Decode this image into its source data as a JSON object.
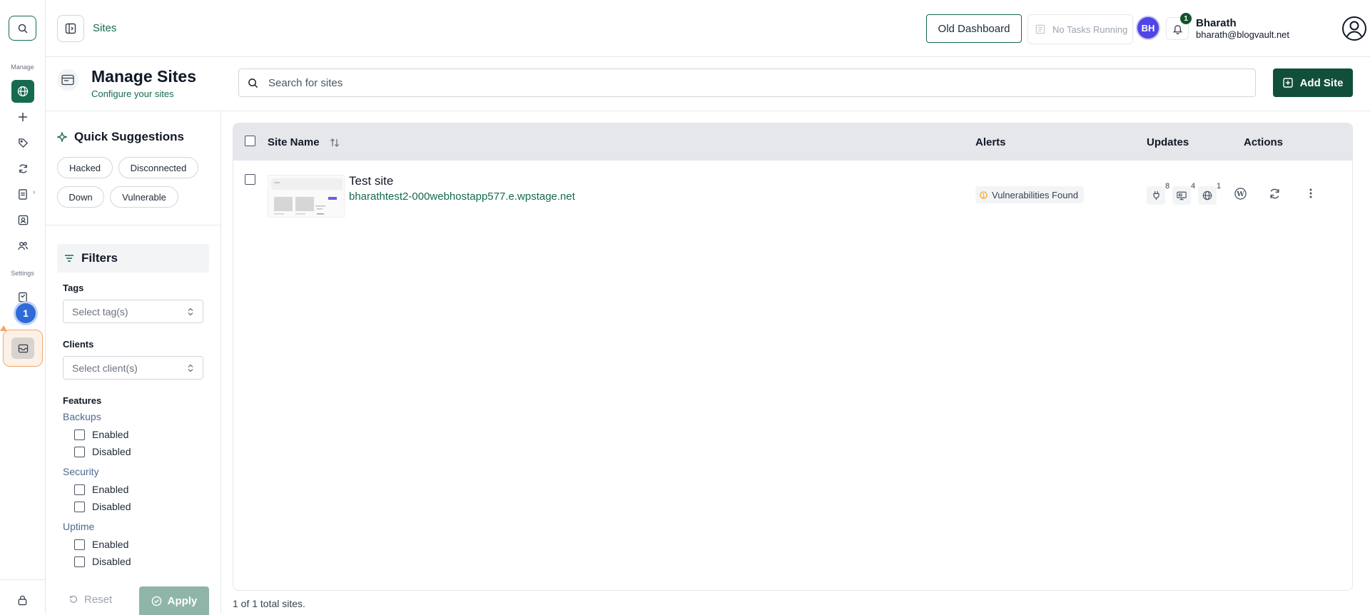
{
  "rail": {
    "manage_label": "Manage",
    "settings_label": "Settings",
    "tour_step": "1",
    "icons": [
      "search-icon",
      "globe-icon",
      "plus-icon",
      "tag-icon",
      "refresh-icon",
      "document-icon",
      "contact-icon",
      "users-icon",
      "bookmark-icon",
      "settings-icon",
      "inbox-icon",
      "lock-icon"
    ]
  },
  "topbar": {
    "breadcrumb": "Sites",
    "old_dashboard": "Old Dashboard",
    "tasks_status": "No Tasks Running",
    "avatar_initials": "BH",
    "notification_count": "1",
    "user_name": "Bharath",
    "user_email": "bharath@blogvault.net"
  },
  "header": {
    "title": "Manage Sites",
    "subtitle": "Configure your sites",
    "search_placeholder": "Search for sites",
    "add_button": "Add Site"
  },
  "quick_suggestions": {
    "title": "Quick Suggestions",
    "chips": [
      "Hacked",
      "Disconnected",
      "Down",
      "Vulnerable"
    ]
  },
  "filters": {
    "title": "Filters",
    "tags_label": "Tags",
    "tags_placeholder": "Select tag(s)",
    "clients_label": "Clients",
    "clients_placeholder": "Select client(s)",
    "features_label": "Features",
    "groups": [
      {
        "label": "Backups",
        "options": [
          "Enabled",
          "Disabled"
        ]
      },
      {
        "label": "Security",
        "options": [
          "Enabled",
          "Disabled"
        ]
      },
      {
        "label": "Uptime",
        "options": [
          "Enabled",
          "Disabled"
        ]
      }
    ],
    "reset": "Reset",
    "apply": "Apply"
  },
  "table": {
    "columns": [
      "Site Name",
      "Alerts",
      "Updates",
      "Actions"
    ],
    "rows": [
      {
        "name": "Test site",
        "url": "bharathtest2-000webhostapp577.e.wpstage.net",
        "alert": "Vulnerabilities Found",
        "updates": [
          {
            "icon": "plugin-icon",
            "count": "8"
          },
          {
            "icon": "theme-icon",
            "count": "4"
          },
          {
            "icon": "core-icon",
            "count": "1"
          }
        ]
      }
    ],
    "footer": "1 of 1 total sites."
  },
  "colors": {
    "brand": "#166a4f",
    "brand_dark": "#124f3b",
    "alert": "#f59e0b",
    "avatar": "#4f46e5",
    "tour": "#2f6bd8"
  }
}
